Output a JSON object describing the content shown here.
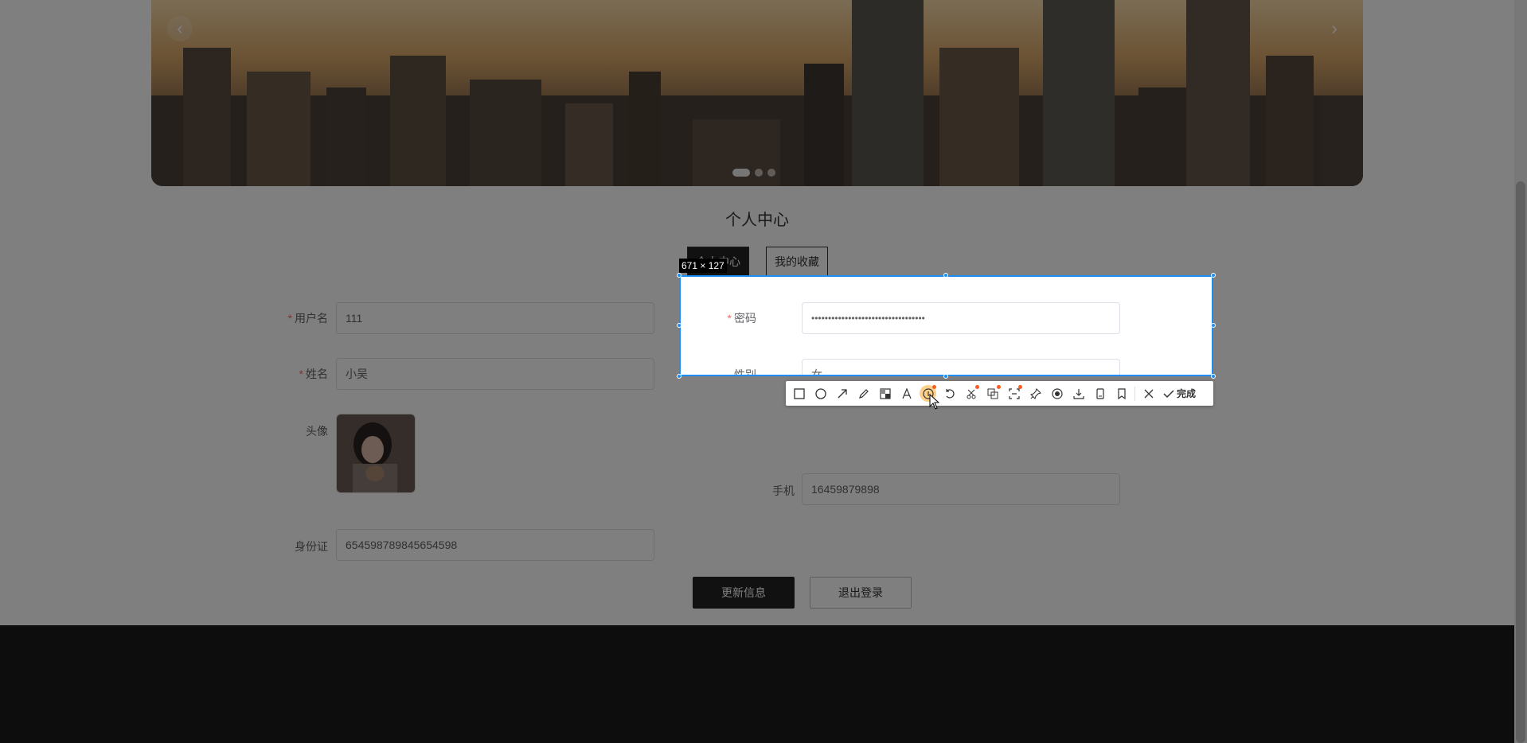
{
  "page": {
    "title": "个人中心",
    "tabs": [
      {
        "label": "个人中心",
        "active": true
      },
      {
        "label": "我的收藏",
        "active": false
      }
    ]
  },
  "form": {
    "username": {
      "label": "用户名",
      "value": "111",
      "required": true
    },
    "password": {
      "label": "密码",
      "value": "••••••••••••••••••••••••••••••••••",
      "required": true
    },
    "name": {
      "label": "姓名",
      "value": "小吴",
      "required": true
    },
    "gender": {
      "label": "性别",
      "value": "女",
      "required": false
    },
    "avatar": {
      "label": "头像"
    },
    "phone": {
      "label": "手机",
      "value": "16459879898"
    },
    "idcard": {
      "label": "身份证",
      "value": "654598789845654598"
    }
  },
  "buttons": {
    "update": "更新信息",
    "logout": "退出登录"
  },
  "capture": {
    "size_text": "671 × 127",
    "done_label": "完成",
    "accent_color": "#1a8ef5"
  },
  "toolbar_icons": [
    "rectangle-icon",
    "ellipse-icon",
    "arrow-icon",
    "pencil-icon",
    "mosaic-icon",
    "text-icon",
    "serial-number-icon",
    "undo-icon",
    "crop-icon",
    "translate-icon",
    "ocr-icon",
    "pin-icon",
    "record-icon",
    "download-icon",
    "long-screenshot-icon",
    "bookmark-icon",
    "close-icon",
    "check-icon"
  ]
}
